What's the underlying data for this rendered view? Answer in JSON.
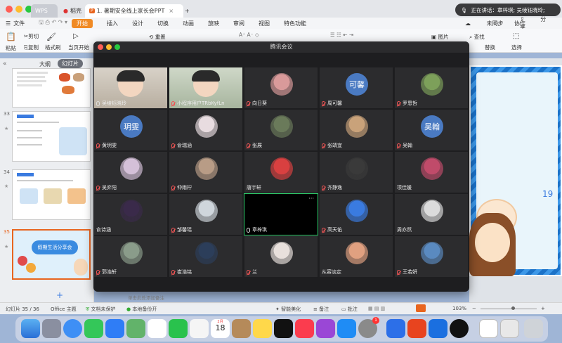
{
  "app": {
    "tabs": [
      {
        "label": "WPS"
      },
      {
        "label": "稻壳"
      },
      {
        "label": "1. 暑期安全线上家长会PPT"
      }
    ],
    "new_tab": "+"
  },
  "notification": {
    "text": "正在讲话：章梓琪; 吴绫钰晓玲;"
  },
  "menubar": {
    "file": "文件",
    "items": [
      "开始",
      "插入",
      "设计",
      "切换",
      "动画",
      "放映",
      "审阅",
      "视图",
      "特色功能"
    ],
    "right": [
      "未同步",
      "协作",
      "分享"
    ]
  },
  "toolbar": {
    "paste": "粘贴",
    "cut": "剪切",
    "copy": "复制",
    "format_painter": "格式刷",
    "from_current": "当页开始",
    "reset": "重置",
    "picture": "图片",
    "find": "查找",
    "replace": "替换",
    "select": "选择"
  },
  "leftpanel": {
    "tab_outline": "大纲",
    "tab_slides": "幻灯片",
    "slides": [
      {
        "num": "33"
      },
      {
        "num": "34"
      },
      {
        "num": "35"
      }
    ],
    "slide35_title": "假期生活分享会"
  },
  "statusbar": {
    "slide_pos": "幻灯片 35 / 36",
    "theme": "Office 主题",
    "protect": "文档未保护",
    "backup": "本地备份开",
    "notes": "单击此处添加备注",
    "beautify": "智能美化",
    "notes_btn": "备注",
    "comment": "批注",
    "zoom": "103%"
  },
  "meeting": {
    "title": "腾讯会议",
    "participants": [
      {
        "name": "吴绫钰晓玲",
        "type": "video",
        "mic": "on"
      },
      {
        "name": "小程序用户TRbKyfLn",
        "type": "video",
        "mic": "off"
      },
      {
        "name": "向日葵",
        "type": "avatar",
        "mic": "off",
        "color": "#d99a9a"
      },
      {
        "name": "周可馨",
        "type": "text",
        "text": "可馨",
        "mic": "off"
      },
      {
        "name": "罗恩哲",
        "type": "avatar",
        "mic": "off",
        "color": "#7da05a"
      },
      {
        "name": "黄玥雯",
        "type": "text",
        "text": "玥雯",
        "mic": "off"
      },
      {
        "name": "俞瑞涵",
        "type": "avatar",
        "mic": "off",
        "color": "#e8dce0"
      },
      {
        "name": "张展",
        "type": "avatar",
        "mic": "off",
        "color": "#6a7a5a"
      },
      {
        "name": "张靖宜",
        "type": "avatar",
        "mic": "off",
        "color": "#c9a27a"
      },
      {
        "name": "吴翰",
        "type": "text",
        "text": "吴翰",
        "mic": "off"
      },
      {
        "name": "吴弈阳",
        "type": "avatar",
        "mic": "off",
        "color": "#d4c0d8"
      },
      {
        "name": "仲雨柠",
        "type": "avatar",
        "mic": "off",
        "color": "#b89c86"
      },
      {
        "name": "唐宇轩",
        "type": "avatar",
        "mic": "none",
        "color": "#d94040"
      },
      {
        "name": "齐静逸",
        "type": "avatar",
        "mic": "off",
        "color": "#3a3a3a"
      },
      {
        "name": "项佳媛",
        "type": "avatar",
        "mic": "none",
        "color": "#c04b6a"
      },
      {
        "name": "俞诗涵",
        "type": "avatar",
        "mic": "none",
        "color": "#3a2a4a"
      },
      {
        "name": "邹馨瑶",
        "type": "avatar",
        "mic": "off",
        "color": "#cfd6dc"
      },
      {
        "name": "章梓琪",
        "type": "active",
        "mic": "on"
      },
      {
        "name": "高天佑",
        "type": "avatar",
        "mic": "off",
        "color": "#3a7be0"
      },
      {
        "name": "周亦然",
        "type": "avatar",
        "mic": "none",
        "color": "#dcdcdc"
      },
      {
        "name": "郭浩轩",
        "type": "avatar",
        "mic": "off",
        "color": "#8a9c8a"
      },
      {
        "name": "崔浩铭",
        "type": "avatar",
        "mic": "off",
        "color": "#2c3e5a"
      },
      {
        "name": "兰",
        "type": "avatar",
        "mic": "off",
        "color": "#e8e0dc"
      },
      {
        "name": "从容淡定",
        "type": "avatar",
        "mic": "none",
        "color": "#e0a080"
      },
      {
        "name": "王若妍",
        "type": "avatar",
        "mic": "off",
        "color": "#5a8ac0"
      }
    ]
  },
  "dock": {
    "calendar_month": "2月",
    "calendar_day": "18",
    "badge": "1"
  },
  "icons": [
    "search-icon",
    "share-icon",
    "mic-icon",
    "mic-off-icon",
    "more-icon"
  ]
}
